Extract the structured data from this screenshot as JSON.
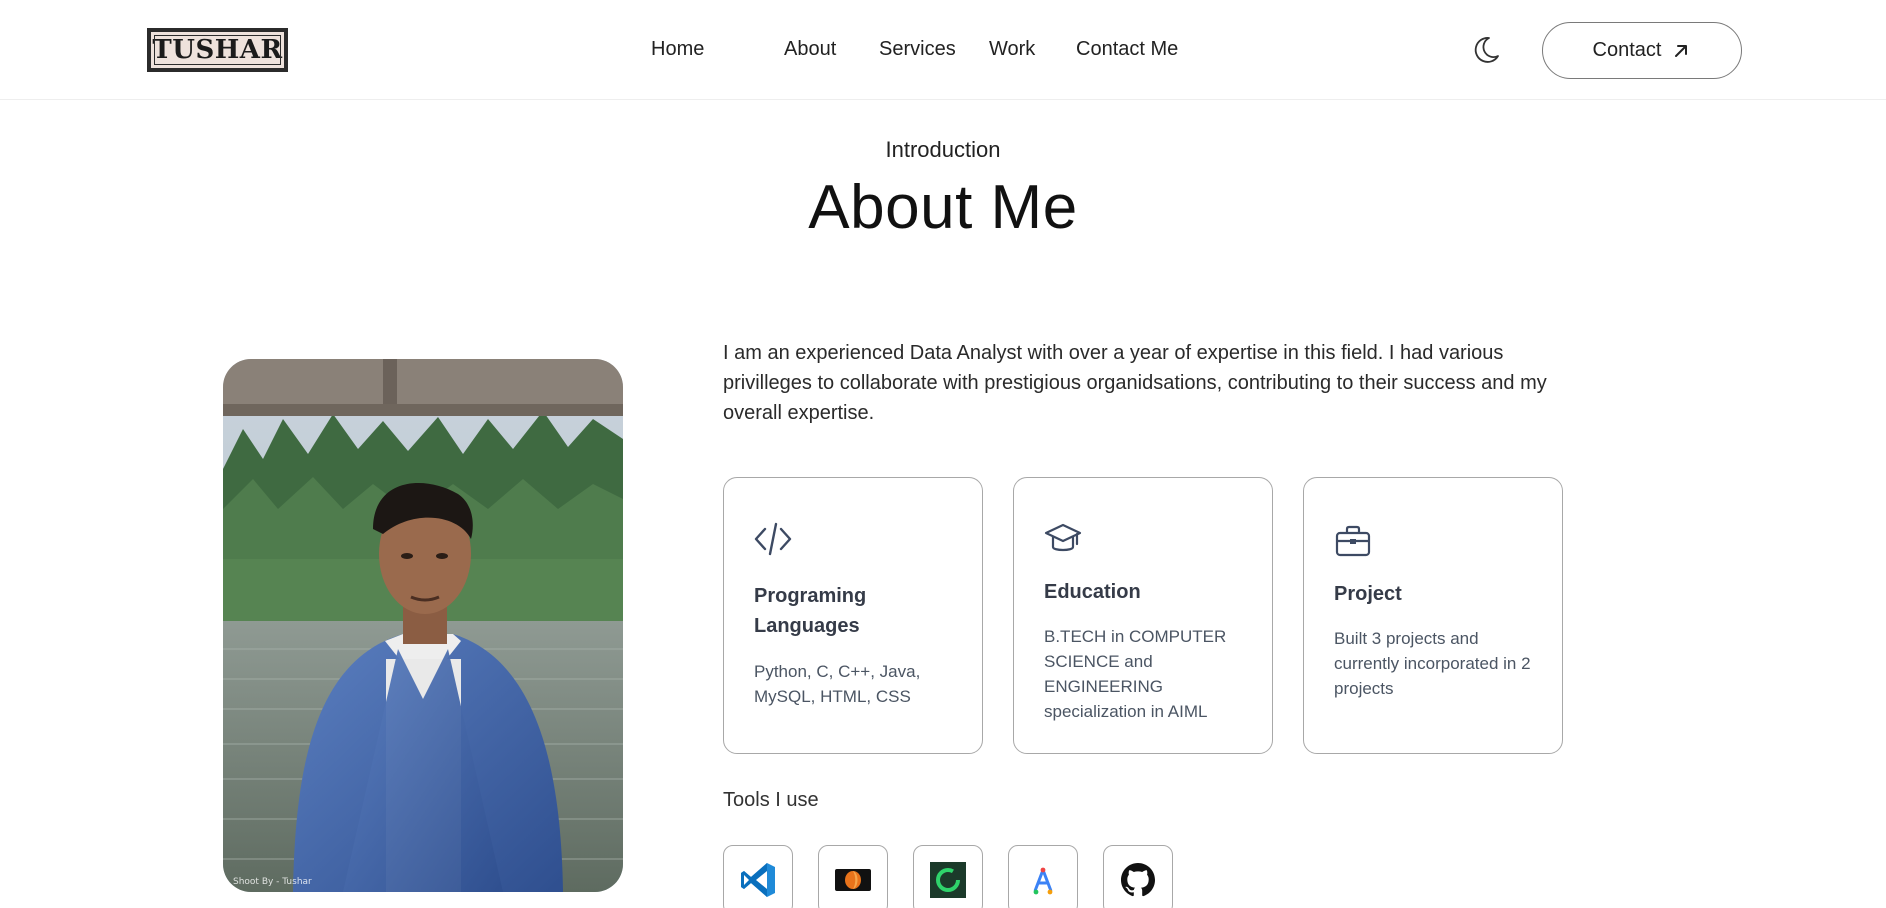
{
  "header": {
    "logo_text": "TUSHAR",
    "nav": [
      "Home",
      "About",
      "Services",
      "Work",
      "Contact Me"
    ],
    "contact_button": "Contact",
    "icons": {
      "theme": "moon-icon",
      "contact_arrow": "arrow-up-right-icon"
    }
  },
  "intro": {
    "label": "Introduction",
    "title": "About Me"
  },
  "photo": {
    "caption": "Shoot By - Tushar"
  },
  "bio": "I am an experienced Data Analyst with over a year of expertise in this field. I had various privilleges to collaborate with prestigious organidsations, contributing to their success and my overall expertise.",
  "cards": [
    {
      "icon": "code-icon",
      "title": "Programing Languages",
      "text": "Python, C, C++, Java, MySQL, HTML, CSS"
    },
    {
      "icon": "graduation-cap-icon",
      "title": "Education",
      "text": "B.TECH in COMPUTER SCIENCE and ENGINEERING specialization in AIML"
    },
    {
      "icon": "briefcase-icon",
      "title": "Project",
      "text": "Built 3 projects and currently incorporated in 2 projects"
    }
  ],
  "tools": {
    "label": "Tools I use",
    "items": [
      "vscode-icon",
      "tool-orange-icon",
      "tool-green-ring-icon",
      "tool-blue-a-icon",
      "github-icon"
    ]
  },
  "colors": {
    "card_heading": "#353b48",
    "card_text": "#4b5563",
    "border": "#a8a8a8",
    "vscode": "#0a7bd0"
  }
}
